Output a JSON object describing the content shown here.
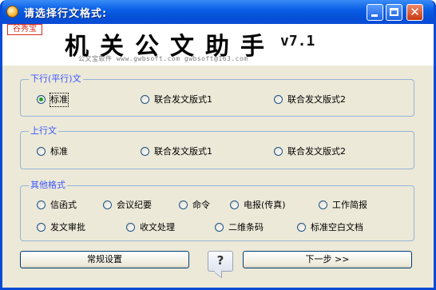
{
  "window": {
    "title": "请选择行文格式:",
    "controls": {
      "minimize": "",
      "maximize": "",
      "close": "✕"
    }
  },
  "banner": {
    "logo_text": "谷秀宝",
    "app_name": "机关公文助手",
    "version": "v7.1",
    "tagline": "公文宝软件 www.gwbsoft.com gwbsoft@163.com"
  },
  "groups": {
    "downward": {
      "label": "下行(平行)文",
      "options": [
        {
          "label": "标准",
          "checked": true
        },
        {
          "label": "联合发文版式1",
          "checked": false
        },
        {
          "label": "联合发文版式2",
          "checked": false
        }
      ]
    },
    "upward": {
      "label": "上行文",
      "options": [
        {
          "label": "标准",
          "checked": false
        },
        {
          "label": "联合发文版式1",
          "checked": false
        },
        {
          "label": "联合发文版式2",
          "checked": false
        }
      ]
    },
    "other": {
      "label": "其他格式",
      "row1": [
        {
          "label": "信函式"
        },
        {
          "label": "会议纪要"
        },
        {
          "label": "命令"
        },
        {
          "label": "电报(传真)"
        },
        {
          "label": "工作简报"
        }
      ],
      "row2": [
        {
          "label": "发文审批"
        },
        {
          "label": "收文处理"
        },
        {
          "label": "二维条码"
        },
        {
          "label": "标准空白文档"
        }
      ]
    }
  },
  "buttons": {
    "settings": "常规设置",
    "help": "?",
    "next": "下一步 >>"
  }
}
